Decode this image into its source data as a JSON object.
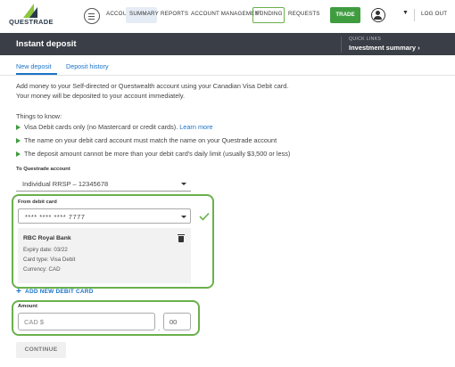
{
  "brand": {
    "logo_text": "QUESTRADE"
  },
  "nav": {
    "accounts": "ACCOUNTS",
    "summary": "SUMMARY",
    "reports": "REPORTS",
    "account_management": "ACCOUNT MANAGEMENT",
    "funding": "FUNDING",
    "requests": "REQUESTS",
    "trade": "TRADE",
    "logout": "LOG OUT",
    "active_item": "SUMMARY",
    "highlighted_item": "FUNDING"
  },
  "header": {
    "title": "Instant deposit",
    "quick_links_label": "QUICK LINKS",
    "quick_link": "Investment summary ›"
  },
  "tabs": [
    {
      "label": "New deposit",
      "active": true
    },
    {
      "label": "Deposit history",
      "active": false
    }
  ],
  "intro": {
    "line1": "Add money to your Self-directed or Questwealth account using your Canadian Visa Debit card.",
    "line2": "Your money will be deposited to your account immediately."
  },
  "things": {
    "heading": "Things to know:",
    "item1_text": "Visa Debit cards only (no Mastercard or credit cards).",
    "item1_link": "Learn more",
    "item2": "The name on your debit card account must match the name on your Questrade account",
    "item3": "The deposit amount cannot be more than your debit card's daily limit (usually $3,500 or less)"
  },
  "to_account": {
    "label": "To Questrade account",
    "value": "Individual RRSP – 12345678"
  },
  "from_card": {
    "label": "From debit card",
    "value": "**** **** **** 7777",
    "validated": true
  },
  "card_details": {
    "bank": "RBC Royal Bank",
    "expiry": "Expiry date: 03/22",
    "type": "Card type: Visa Debit",
    "currency": "Currency: CAD"
  },
  "add_card": {
    "label": "ADD NEW DEBIT CARD"
  },
  "amount": {
    "label": "Amount",
    "dollars_placeholder": "CAD $",
    "cents_value": "00",
    "separator": "."
  },
  "continue_label": "CONTINUE",
  "colors": {
    "accent_blue": "#1a73c9",
    "trade_green": "#3f9c3f",
    "highlight_green": "#6ab04c",
    "header_bg": "#3a3e46",
    "summary_bg": "#e6ecf5"
  }
}
